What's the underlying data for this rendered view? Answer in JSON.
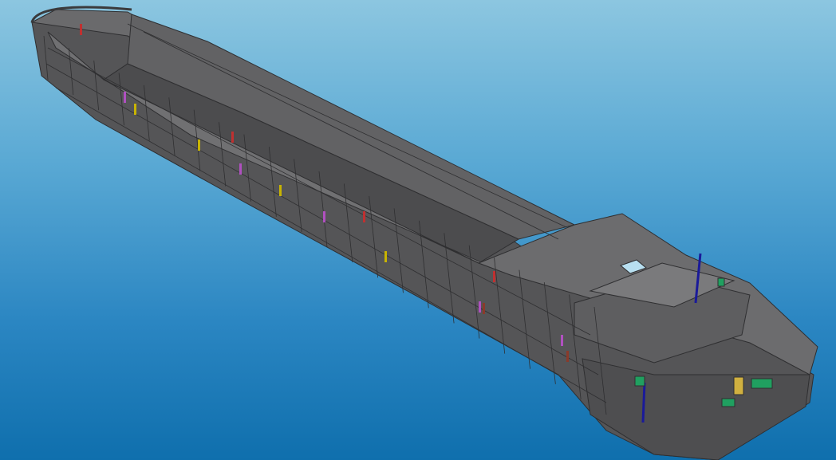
{
  "viewport": {
    "background_top": "#8cc6e0",
    "background_bottom": "#0f6fad"
  },
  "model": {
    "hull_color": "#5d5d5f",
    "hull_dark": "#49494b",
    "hull_light": "#6e6e70",
    "edge_color": "#2f2f31",
    "accent_colors": [
      "#c8b400",
      "#b050c0",
      "#c03030",
      "#1a1a9a",
      "#20a060",
      "#d0b040",
      "#8a3a2a"
    ]
  }
}
